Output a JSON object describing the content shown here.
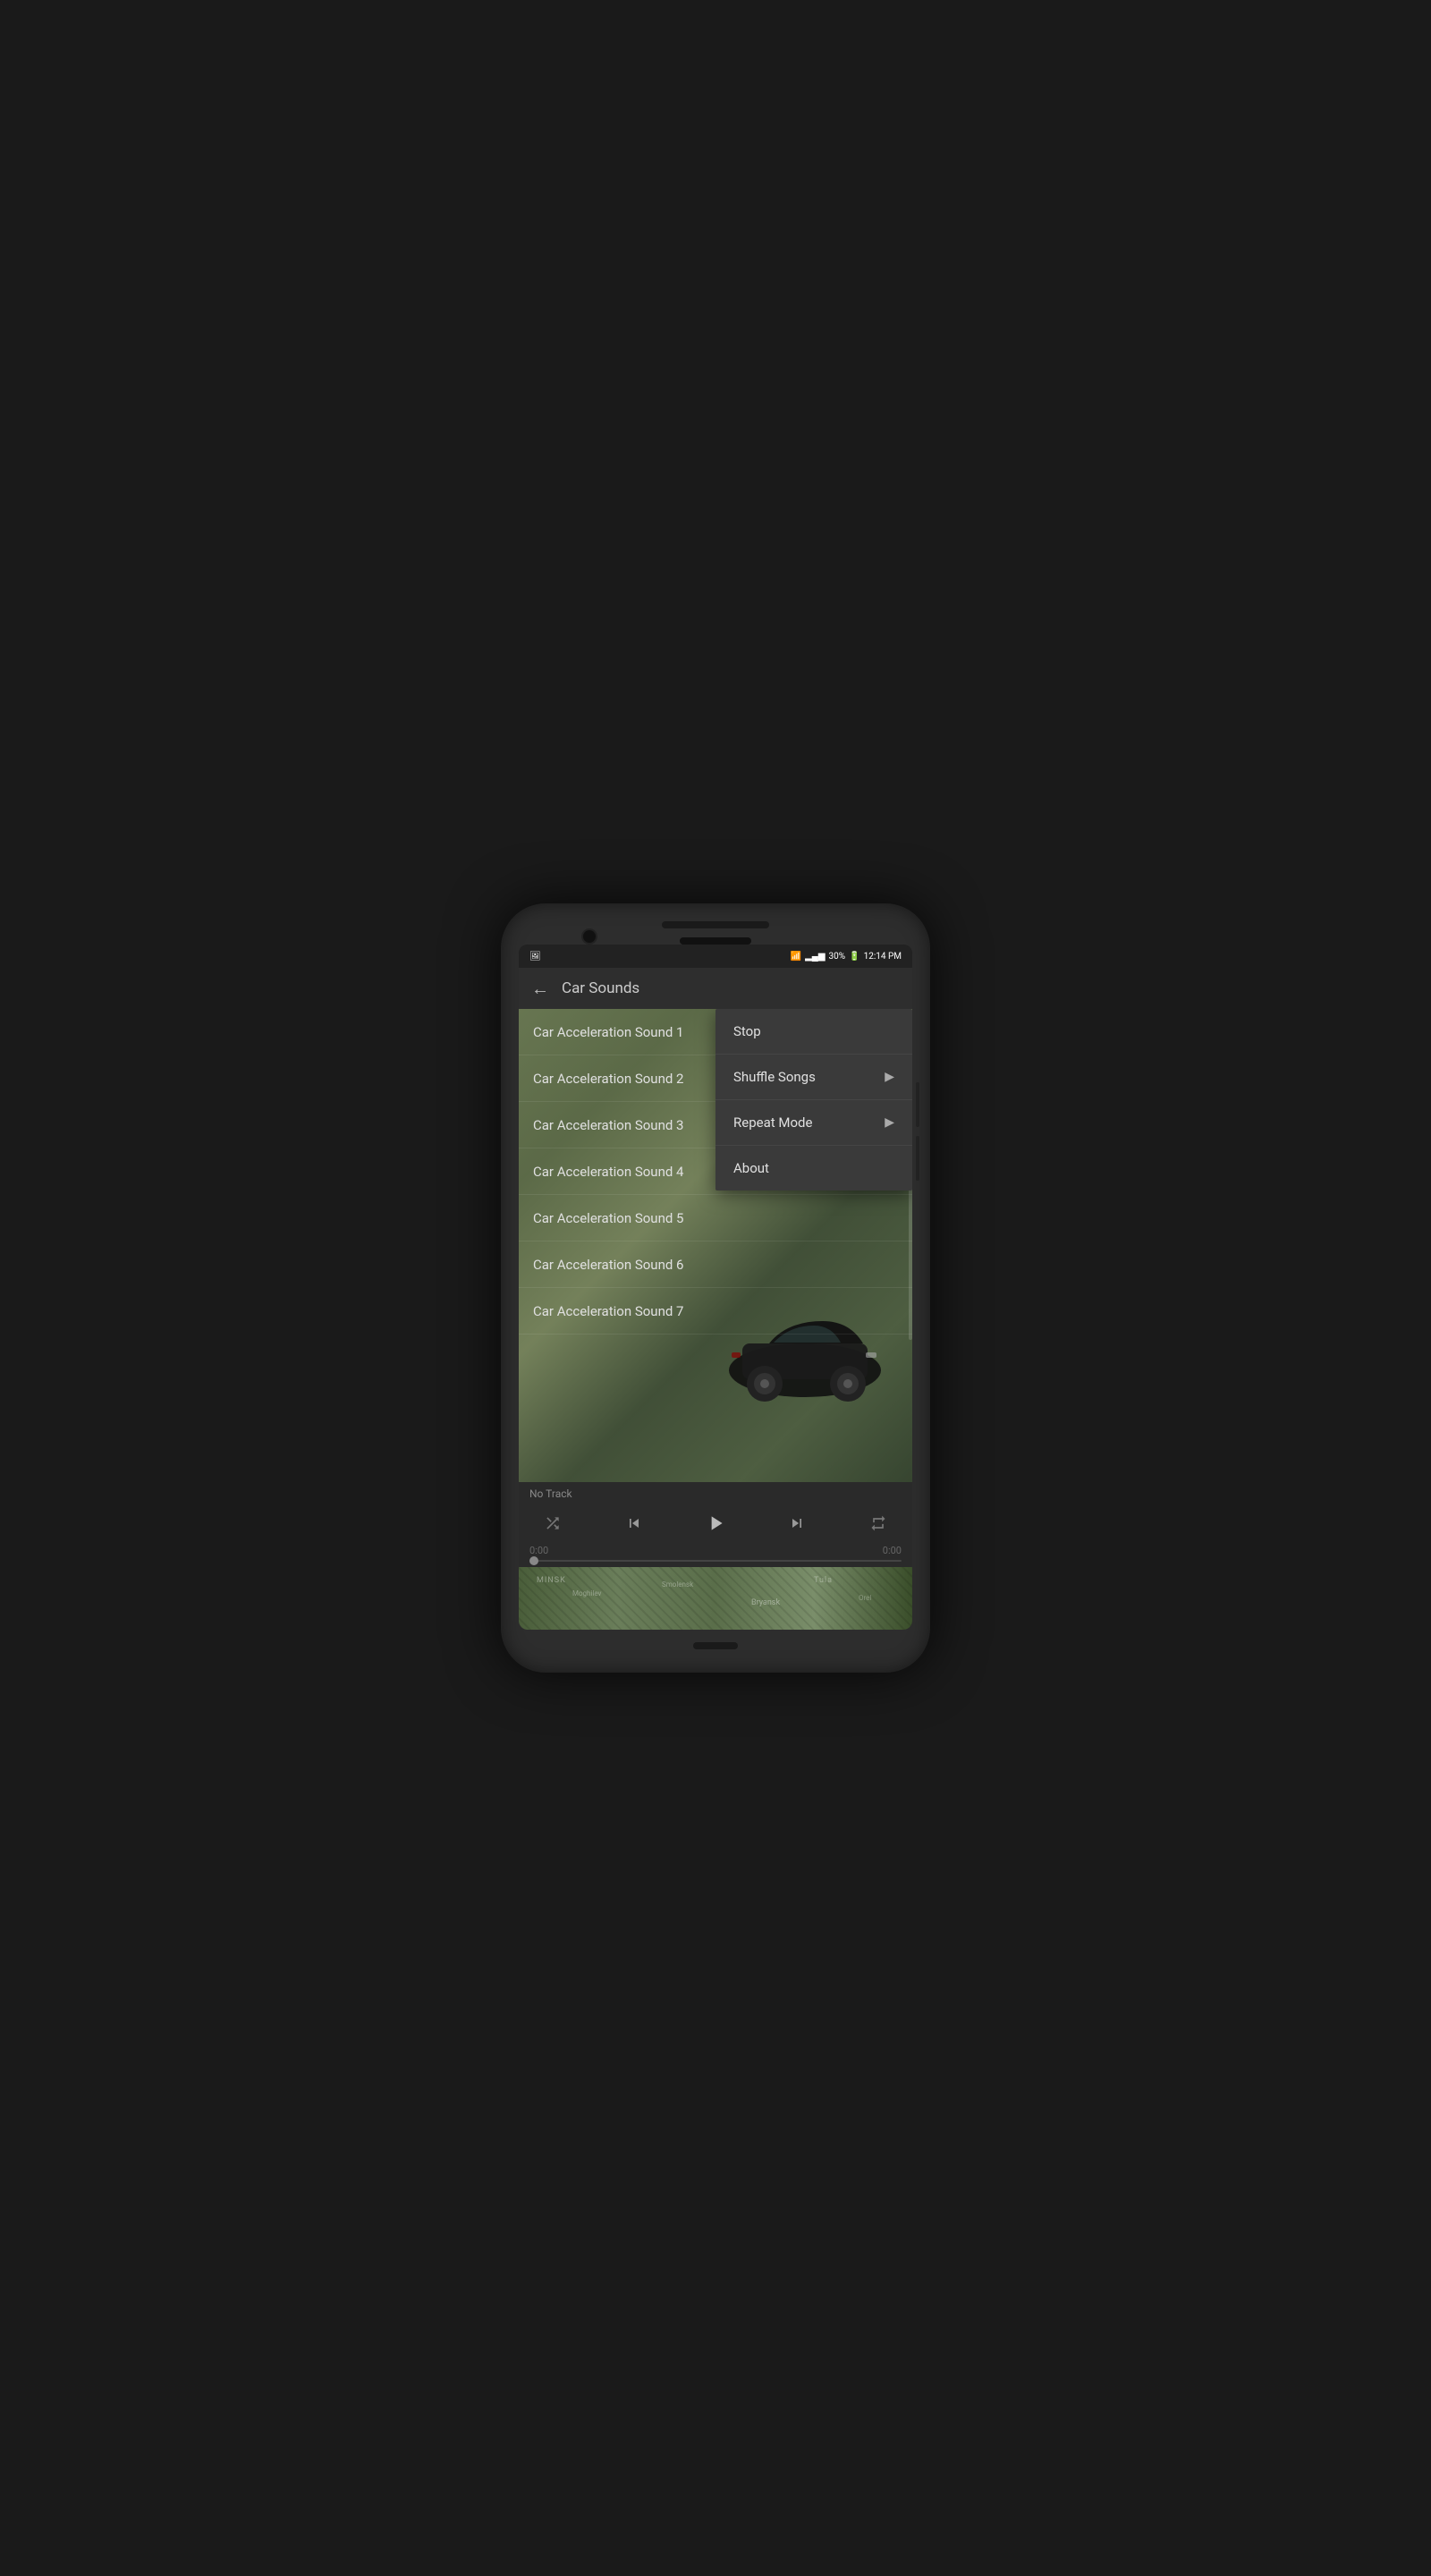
{
  "statusBar": {
    "leftIcon": "🖼",
    "signal1": "ᵢₗ",
    "signal2": "ₗₗ",
    "battery": "30%",
    "time": "12:14 PM"
  },
  "toolbar": {
    "title": "Car Sounds",
    "backLabel": "←"
  },
  "songs": [
    {
      "id": 1,
      "name": "Car Acceleration Sound 1"
    },
    {
      "id": 2,
      "name": "Car Acceleration Sound 2"
    },
    {
      "id": 3,
      "name": "Car Acceleration Sound 3"
    },
    {
      "id": 4,
      "name": "Car Acceleration Sound 4"
    },
    {
      "id": 5,
      "name": "Car Acceleration Sound 5"
    },
    {
      "id": 6,
      "name": "Car Acceleration Sound 6"
    },
    {
      "id": 7,
      "name": "Car Acceleration Sound 7"
    }
  ],
  "contextMenu": {
    "items": [
      {
        "id": "stop",
        "label": "Stop",
        "hasArrow": false
      },
      {
        "id": "shuffle",
        "label": "Shuffle Songs",
        "hasArrow": true
      },
      {
        "id": "repeat",
        "label": "Repeat Mode",
        "hasArrow": true
      },
      {
        "id": "about",
        "label": "About",
        "hasArrow": false
      }
    ]
  },
  "player": {
    "noTrack": "No Track",
    "timeStart": "0:00",
    "timeEnd": "0:00"
  }
}
